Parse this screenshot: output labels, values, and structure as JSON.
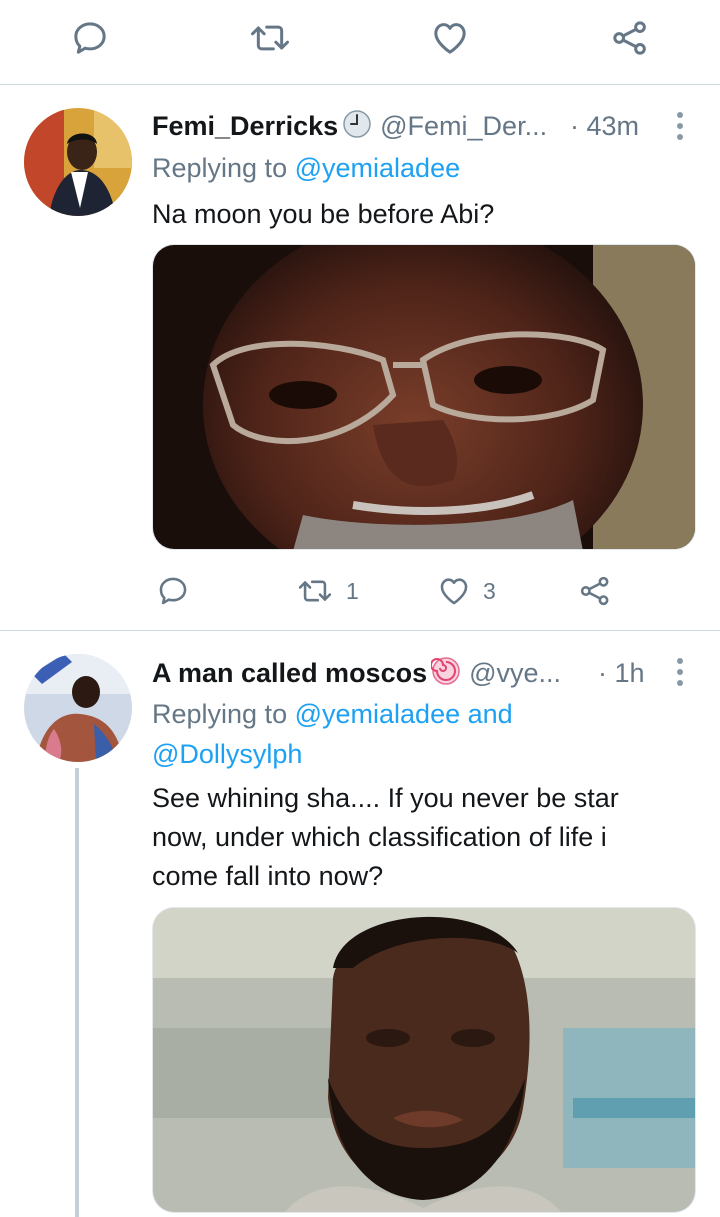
{
  "top_actions": {
    "reply_icon": "reply-icon",
    "retweet_icon": "retweet-icon",
    "like_icon": "heart-icon",
    "share_icon": "share-icon"
  },
  "tweets": [
    {
      "display_name": "Femi_Derricks",
      "name_emoji": "clock-emoji",
      "handle": "@Femi_Der...",
      "time": "· 43m",
      "replying_prefix": "Replying to",
      "replying_to": "@yemialadee",
      "text": "Na moon you be before Abi?",
      "media_desc": "close-up photo of older man with glasses",
      "actions": {
        "reply_count": "",
        "retweet_count": "1",
        "like_count": "3"
      }
    },
    {
      "display_name": "A man called moscos",
      "name_emoji": "lollipop-emoji",
      "handle": "@vye...",
      "time": "· 1h",
      "replying_prefix": "Replying to",
      "replying_to_1": "@yemialadee",
      "replying_and": "and",
      "replying_to_2": "@Dollysylph",
      "text_line_1": "See whining sha.... If you never be star",
      "text_line_2": "now, under which classification of life i",
      "text_line_3": "come fall into now?",
      "media_desc": "photo of bearded man looking down"
    }
  ],
  "colors": {
    "accent": "#1da1f2",
    "secondary_text": "#657786",
    "primary_text": "#14171a",
    "divider": "#cfd9de"
  }
}
